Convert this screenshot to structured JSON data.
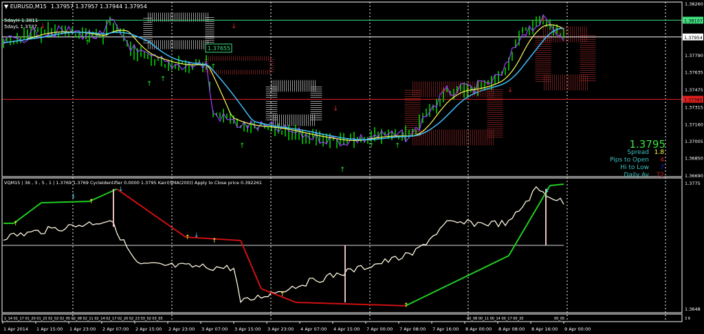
{
  "header": {
    "symbol": "EURUSD,M15",
    "ohlc": "1.37957 1.37957 1.37944 1.37954"
  },
  "levels_text": {
    "high": "5dayH 1.3811",
    "low": "5dayL 1.3737",
    "marker": "1.37655"
  },
  "indicator_header": "VQM15 | 36 , 3 , 5 , 1 | 1.3769 1.3769 CycleIdentifier 0.0000 1.3795 Kairi(SMA(200)) Apply to Close price 0.392261",
  "info": {
    "price": "1.3795",
    "rows": [
      {
        "label": "Spread",
        "value": "1.8",
        "color": "#ffff40"
      },
      {
        "label": "Pips to Open",
        "value": "4",
        "color": "#e02020"
      },
      {
        "label": "Hi to Low",
        "value": "7",
        "color": "#2020e0"
      },
      {
        "label": "Daily Av",
        "value": "72",
        "color": "#c02020"
      }
    ]
  },
  "strip_labels": {
    "left": "1_14 01_17 01_20 01_23 02_02 02_05 02_08 02_11 02_14 02_17 02_20 02_23 03_02 03_05",
    "right": "00_08 00_11 00_14 00_17 00_20",
    "right2": "00_05",
    "axis": "3 8"
  },
  "colors": {
    "bull": "#00e000",
    "purple": "#a040ff",
    "green_line": "#40e080",
    "red_line": "#e02020",
    "osc_green": "#20d020",
    "osc_red": "#d01010"
  },
  "chart_data": [
    {
      "type": "line",
      "title": "EURUSD,M15",
      "ylim": [
        1.3669,
        1.3826
      ],
      "y_ticks": [
        "1.38260",
        "1.37790",
        "1.37635",
        "1.37475",
        "1.37315",
        "1.37160",
        "1.37005",
        "1.36850",
        "1.36690"
      ],
      "price_labels": [
        {
          "value": 1.38107,
          "text": "1.38107",
          "color": "#40e080"
        },
        {
          "value": 1.37954,
          "text": "1.37954",
          "color": "#ffffff"
        },
        {
          "value": 1.37385,
          "text": "1.37385",
          "color": "#e02020"
        }
      ],
      "series": [
        {
          "name": "close",
          "points": [
            [
              0,
              1.379
            ],
            [
              11,
              1.38
            ],
            [
              20,
              1.38
            ],
            [
              29,
              1.3795
            ],
            [
              31,
              1.381
            ],
            [
              39,
              1.378
            ],
            [
              49,
              1.377
            ],
            [
              59,
              1.377
            ],
            [
              61,
              1.3725
            ],
            [
              69,
              1.3715
            ],
            [
              79,
              1.3712
            ],
            [
              89,
              1.3705
            ],
            [
              99,
              1.37
            ],
            [
              109,
              1.3705
            ],
            [
              119,
              1.3705
            ],
            [
              123,
              1.3725
            ],
            [
              129,
              1.3745
            ],
            [
              139,
              1.375
            ],
            [
              145,
              1.376
            ],
            [
              151,
              1.38
            ],
            [
              157,
              1.381
            ],
            [
              163,
              1.3795
            ]
          ]
        }
      ]
    },
    {
      "type": "line",
      "title": "VQM15 / CycleIdentifier",
      "ylim": [
        1.3648,
        1.3775
      ],
      "y_ticks": [
        "1.3775",
        "1.3648"
      ],
      "baseline": 1.37125,
      "series": [
        {
          "name": "price",
          "points": [
            [
              0,
              1.37207
            ],
            [
              31,
              1.37376
            ],
            [
              39,
              1.36935
            ],
            [
              67,
              1.36901
            ],
            [
              69,
              1.36562
            ],
            [
              89,
              1.36765
            ],
            [
              119,
              1.37037
            ],
            [
              129,
              1.37343
            ],
            [
              147,
              1.37343
            ],
            [
              155,
              1.37682
            ],
            [
              163,
              1.37546
            ]
          ]
        },
        {
          "name": "vqm",
          "points": [
            [
              0,
              1.37343
            ],
            [
              3,
              1.37343
            ],
            [
              11,
              1.37546
            ],
            [
              25,
              1.3756
            ],
            [
              33,
              1.37682
            ],
            [
              53,
              1.37207
            ],
            [
              69,
              1.37173
            ],
            [
              75,
              1.36697
            ],
            [
              85,
              1.36562
            ],
            [
              117,
              1.36528
            ],
            [
              147,
              1.37023
            ],
            [
              159,
              1.37716
            ],
            [
              163,
              1.3773
            ]
          ]
        }
      ]
    }
  ],
  "x_ticks": [
    "1 Apr 2014",
    "1 Apr 15:00",
    "1 Apr 23:00",
    "2 Apr 07:00",
    "2 Apr 15:00",
    "2 Apr 23:00",
    "3 Apr 07:00",
    "3 Apr 15:00",
    "3 Apr 23:00",
    "4 Apr 07:00",
    "4 Apr 15:00",
    "7 Apr 00:00",
    "7 Apr 08:00",
    "7 Apr 16:00",
    "8 Apr 00:00",
    "8 Apr 08:00",
    "8 Apr 16:00",
    "9 Apr 00:00"
  ]
}
